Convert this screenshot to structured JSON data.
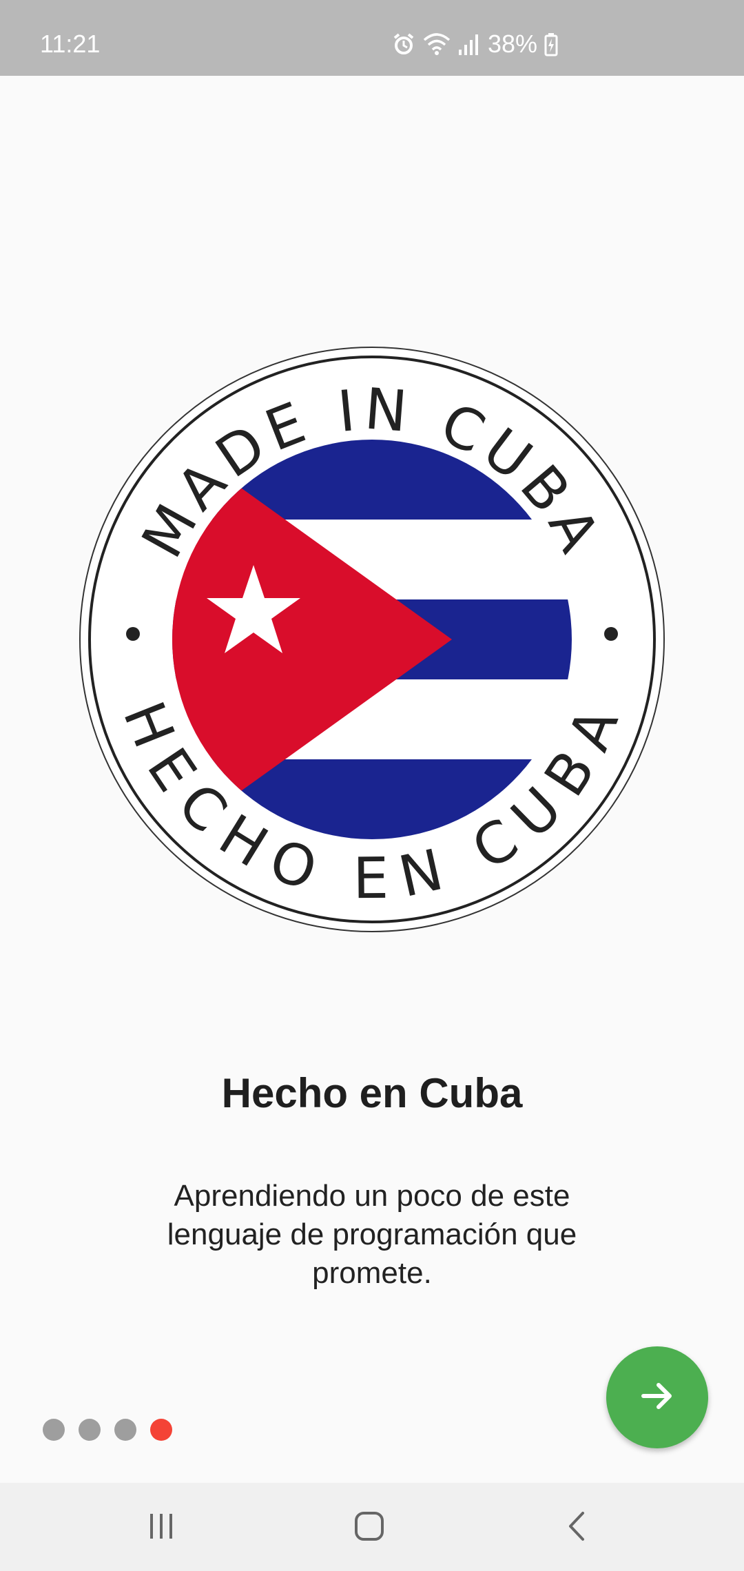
{
  "status_bar": {
    "time": "11:21",
    "battery": "38%",
    "icons": [
      "alarm-icon",
      "wifi-icon",
      "signal-icon",
      "battery-charging-icon"
    ]
  },
  "emblem": {
    "top_text": "MADE IN CUBA",
    "bottom_text": "HECHO EN CUBA",
    "colors": {
      "blue": "#1a2490",
      "red": "#d90d2b",
      "white": "#ffffff"
    }
  },
  "content": {
    "title": "Hecho en Cuba",
    "description": "Aprendiendo un poco de este lenguaje de programación que promete."
  },
  "pager": {
    "total": 4,
    "active_index": 3,
    "active_color": "#f44336",
    "inactive_color": "#9e9e9e"
  },
  "next_button": {
    "icon": "arrow-right-icon",
    "color": "#4caf50"
  },
  "nav_bar": {
    "buttons": [
      "recent-apps-icon",
      "home-icon",
      "back-icon"
    ]
  }
}
